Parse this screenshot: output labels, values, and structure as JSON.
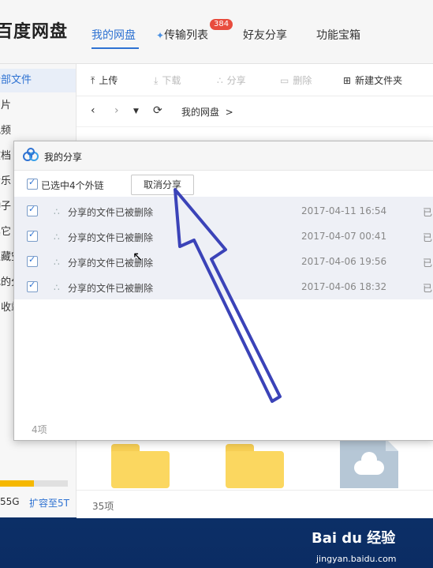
{
  "app": {
    "brand": "百度网盘",
    "tabs": [
      {
        "label": "我的网盘"
      },
      {
        "label": "传输列表",
        "badge": "384"
      },
      {
        "label": "好友分享"
      },
      {
        "label": "功能宝箱"
      }
    ]
  },
  "sidebar": {
    "items": [
      "全部文件",
      "图片",
      "视频",
      "文档",
      "音乐",
      "种子",
      "其它",
      "隐藏空间",
      "我的分享",
      "回收站"
    ],
    "quota": {
      "used_label": "55G",
      "expand_label": "扩容至5T",
      "fill_fraction": 0.5
    }
  },
  "toolbar": {
    "upload": "上传",
    "download": "下载",
    "share": "分享",
    "delete": "删除",
    "new_folder": "新建文件夹"
  },
  "navbar": {
    "breadcrumb": "我的网盘",
    "sep": ">"
  },
  "statusbar": {
    "count": "35项"
  },
  "dialog": {
    "title": "我的分享",
    "selected_label": "已选中4个外链",
    "cancel_share": "取消分享",
    "rows": [
      {
        "name": "分享的文件已被删除",
        "date": "2017-04-11 16:54",
        "status": "已"
      },
      {
        "name": "分享的文件已被删除",
        "date": "2017-04-07 00:41",
        "status": "已"
      },
      {
        "name": "分享的文件已被删除",
        "date": "2017-04-06 19:56",
        "status": "已"
      },
      {
        "name": "分享的文件已被删除",
        "date": "2017-04-06 18:32",
        "status": "已"
      }
    ],
    "count": "4项"
  },
  "watermark": {
    "main": "Bai du 经验",
    "sub": "jingyan.baidu.com"
  },
  "colors": {
    "accent": "#2e72d2",
    "badge": "#e84c3d",
    "annotation_arrow": "#3b43b8",
    "folder": "#fbd760"
  }
}
